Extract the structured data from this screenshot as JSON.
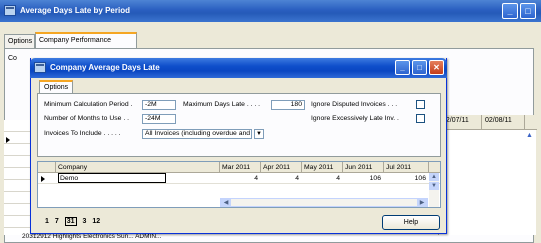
{
  "background": {
    "title": "Average Days Late by Period",
    "tabs": [
      "Options",
      "Company Performance"
    ],
    "panel_cut_text": "Co",
    "dates": [
      "02/07/11",
      "02/08/11"
    ],
    "bottom_row_text": "20312912  Highlights Electronics Sun...  ADMIN..."
  },
  "dialog": {
    "title": "Company Average Days Late",
    "tab": "Options",
    "fields": {
      "min_calc_period_label": "Minimum Calculation Period  .",
      "min_calc_period_value": "-2M",
      "max_days_late_label": "Maximum Days Late  .  .  .  .",
      "max_days_late_value": "180",
      "ignore_disputed_label": "Ignore Disputed Invoices  .  .  .",
      "months_to_use_label": "Number of Months to Use  .  .",
      "months_to_use_value": "-24M",
      "ignore_late_label": "Ignore Excessively Late Inv.  .",
      "invoices_label": "Invoices To Include  .  .  .  .  .",
      "invoices_value": "All Invoices (including overdue and not fully paid)"
    },
    "grid": {
      "headers": [
        "Company",
        "Mar 2011",
        "Apr 2011",
        "May 2011",
        "Jun 2011",
        "Jul 2011"
      ],
      "rows": [
        {
          "company": "Demo",
          "values": [
            "4",
            "4",
            "4",
            "106",
            "106"
          ]
        }
      ]
    },
    "periods": [
      "1",
      "7",
      "31",
      "3",
      "12"
    ],
    "help_label": "Help"
  }
}
